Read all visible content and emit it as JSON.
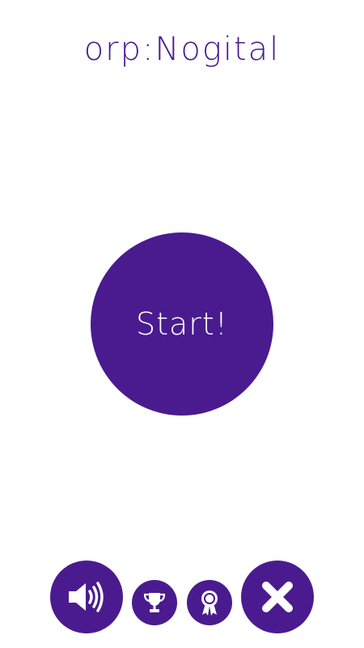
{
  "app": {
    "title": "orp:Nogital"
  },
  "main": {
    "start_label": "Start!"
  },
  "toolbar": {
    "sound_icon": "speaker-volume-icon",
    "leaderboard_icon": "trophy-icon",
    "achievements_icon": "award-ribbon-icon",
    "exit_icon": "close-x-icon"
  },
  "colors": {
    "accent": "#4a1b8f",
    "background": "#ffffff",
    "icon": "#ffffff"
  }
}
